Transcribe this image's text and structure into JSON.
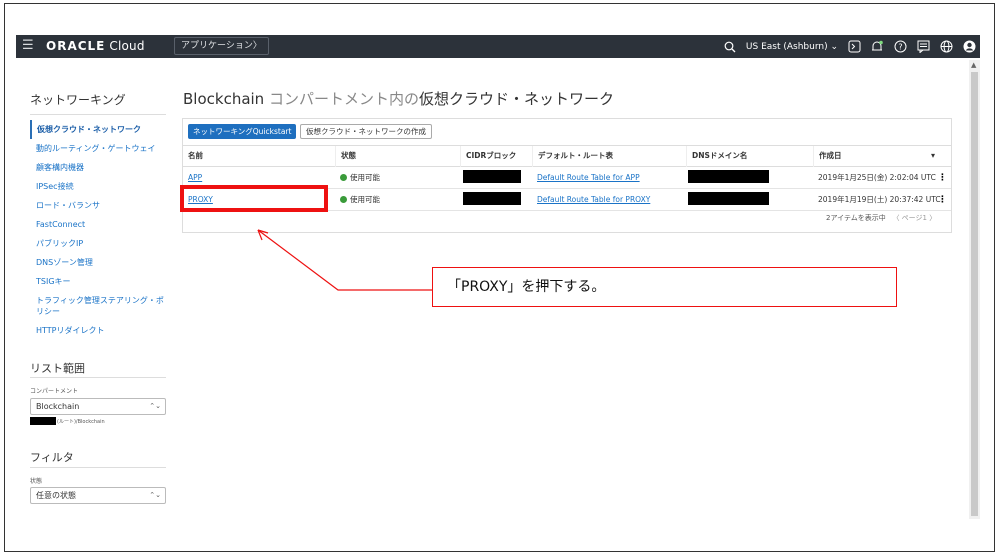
{
  "topbar": {
    "menu_icon": "hamburger-icon",
    "brand_main": "ORACLE",
    "brand_sub": " Cloud",
    "app_button": "アプリケーション〉",
    "region": "US East (Ashburn) ⌄",
    "icons": [
      "search-icon",
      "cloud-shell-icon",
      "bell-icon",
      "help-icon",
      "chat-icon",
      "globe-icon",
      "user-icon"
    ]
  },
  "sidebar": {
    "heading": "ネットワーキング",
    "items": [
      {
        "label": "仮想クラウド・ネットワーク",
        "active": true
      },
      {
        "label": "動的ルーティング・ゲートウェイ"
      },
      {
        "label": "顧客構内機器"
      },
      {
        "label": "IPSec接続"
      },
      {
        "label": "ロード・バランサ"
      },
      {
        "label": "FastConnect"
      },
      {
        "label": "パブリックIP"
      },
      {
        "label": "DNSゾーン管理"
      },
      {
        "label": "TSIGキー"
      },
      {
        "label": "トラフィック管理ステアリング・ポリシー"
      },
      {
        "label": "HTTPリダイレクト"
      }
    ],
    "scope_heading": "リスト範囲",
    "compartment_label": "コンパートメント",
    "compartment_value": "Blockchain",
    "compartment_path": "(ルート)/Blockchain",
    "filter_heading": "フィルタ",
    "state_label": "状態",
    "state_value": "任意の状態"
  },
  "main": {
    "title_prefix": "Blockchain",
    "title_mid": " コンパートメント内の",
    "title_suffix": "仮想クラウド・ネットワーク",
    "quickstart_button": "ネットワーキングQuickstart",
    "create_button": "仮想クラウド・ネットワークの作成",
    "columns": [
      "名前",
      "状態",
      "CIDRブロック",
      "デフォルト・ルート表",
      "DNSドメイン名",
      "作成日"
    ],
    "sort_indicator": "▾",
    "rows": [
      {
        "name": "APP",
        "state": "使用可能",
        "route_table": "Default Route Table for APP",
        "created": "2019年1月25日(金) 2:02:04 UTC"
      },
      {
        "name": "PROXY",
        "state": "使用可能",
        "route_table": "Default Route Table for PROXY",
        "created": "2019年1月19日(土) 20:37:42 UTC"
      }
    ],
    "footer_count": "2アイテムを表示中",
    "footer_page": "〈 ページ1 〉"
  },
  "annotation": {
    "callout_text": "「PROXY」を押下する。",
    "highlight_color": "#ee1111"
  }
}
